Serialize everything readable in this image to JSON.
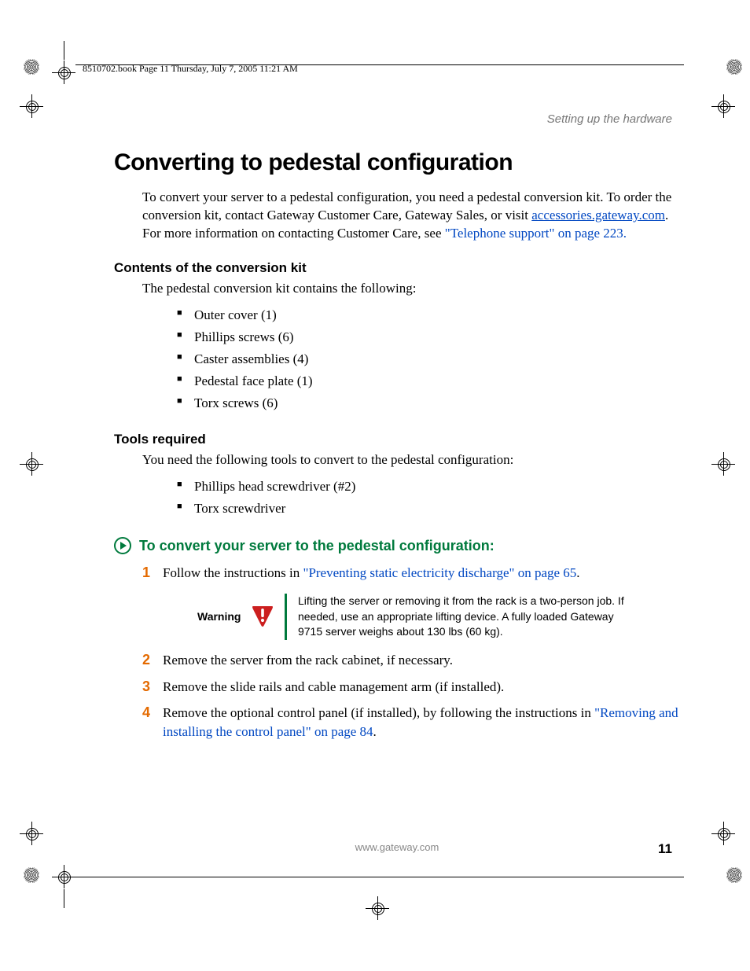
{
  "meta": {
    "book_tag": "8510702.book  Page 11  Thursday, July 7, 2005  11:21 AM",
    "running_head": "Setting up the hardware"
  },
  "title": "Converting to pedestal configuration",
  "intro": {
    "pre": "To convert your server to a pedestal configuration, you need a pedestal conversion kit. To order the conversion kit, contact Gateway Customer Care, Gateway Sales, or visit ",
    "link_text": "accessories.gateway.com",
    "mid": ". For more information on contacting Customer Care, see ",
    "xref": "\"Telephone support\" on page 223.",
    "post": ""
  },
  "sections": {
    "contents": {
      "head": "Contents of the conversion kit",
      "lead": "The pedestal conversion kit contains the following:",
      "items": [
        "Outer cover (1)",
        "Phillips screws (6)",
        "Caster assemblies (4)",
        "Pedestal face plate (1)",
        "Torx screws (6)"
      ]
    },
    "tools": {
      "head": "Tools required",
      "lead": "You need the following tools to convert to the pedestal configuration:",
      "items": [
        "Phillips head screwdriver (#2)",
        "Torx screwdriver"
      ]
    }
  },
  "procedure": {
    "title": "To convert your server to the pedestal configuration:",
    "steps": {
      "s1_pre": "Follow the instructions in ",
      "s1_link": "\"Preventing static electricity discharge\" on page 65",
      "s1_post": ".",
      "s2": "Remove the server from the rack cabinet, if necessary.",
      "s3": "Remove the slide rails and cable management arm (if installed).",
      "s4_pre": "Remove the optional control panel (if installed), by following the instructions in ",
      "s4_link": "\"Removing and installing the control panel\" on page 84",
      "s4_post": "."
    },
    "warning": {
      "label": "Warning",
      "text": "Lifting the server or removing it from the rack is a two-person job. If needed, use an appropriate lifting device. A fully loaded Gateway 9715 server weighs about 130 lbs (60 kg)."
    }
  },
  "footer": {
    "url": "www.gateway.com",
    "page": "11"
  }
}
